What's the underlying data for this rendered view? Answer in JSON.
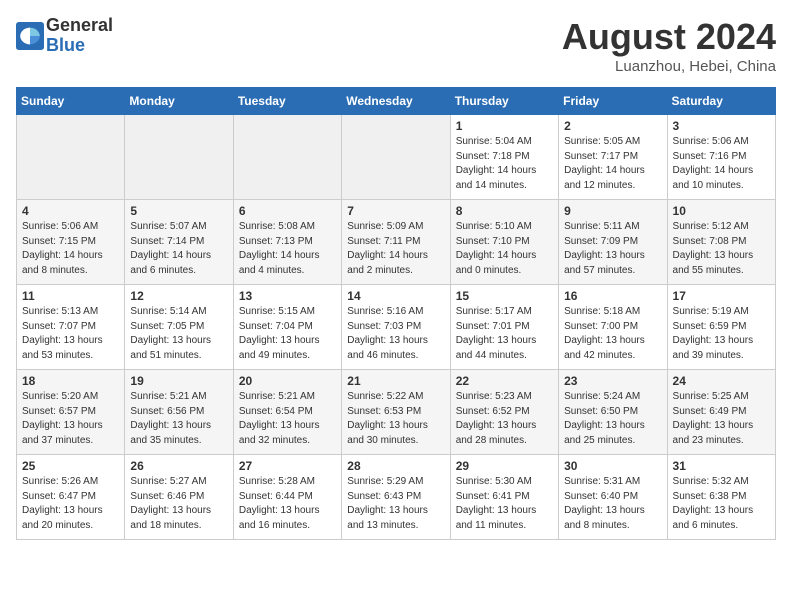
{
  "logo": {
    "line1": "General",
    "line2": "Blue"
  },
  "title": "August 2024",
  "location": "Luanzhou, Hebei, China",
  "weekdays": [
    "Sunday",
    "Monday",
    "Tuesday",
    "Wednesday",
    "Thursday",
    "Friday",
    "Saturday"
  ],
  "weeks": [
    [
      {
        "day": "",
        "info": ""
      },
      {
        "day": "",
        "info": ""
      },
      {
        "day": "",
        "info": ""
      },
      {
        "day": "",
        "info": ""
      },
      {
        "day": "1",
        "info": "Sunrise: 5:04 AM\nSunset: 7:18 PM\nDaylight: 14 hours\nand 14 minutes."
      },
      {
        "day": "2",
        "info": "Sunrise: 5:05 AM\nSunset: 7:17 PM\nDaylight: 14 hours\nand 12 minutes."
      },
      {
        "day": "3",
        "info": "Sunrise: 5:06 AM\nSunset: 7:16 PM\nDaylight: 14 hours\nand 10 minutes."
      }
    ],
    [
      {
        "day": "4",
        "info": "Sunrise: 5:06 AM\nSunset: 7:15 PM\nDaylight: 14 hours\nand 8 minutes."
      },
      {
        "day": "5",
        "info": "Sunrise: 5:07 AM\nSunset: 7:14 PM\nDaylight: 14 hours\nand 6 minutes."
      },
      {
        "day": "6",
        "info": "Sunrise: 5:08 AM\nSunset: 7:13 PM\nDaylight: 14 hours\nand 4 minutes."
      },
      {
        "day": "7",
        "info": "Sunrise: 5:09 AM\nSunset: 7:11 PM\nDaylight: 14 hours\nand 2 minutes."
      },
      {
        "day": "8",
        "info": "Sunrise: 5:10 AM\nSunset: 7:10 PM\nDaylight: 14 hours\nand 0 minutes."
      },
      {
        "day": "9",
        "info": "Sunrise: 5:11 AM\nSunset: 7:09 PM\nDaylight: 13 hours\nand 57 minutes."
      },
      {
        "day": "10",
        "info": "Sunrise: 5:12 AM\nSunset: 7:08 PM\nDaylight: 13 hours\nand 55 minutes."
      }
    ],
    [
      {
        "day": "11",
        "info": "Sunrise: 5:13 AM\nSunset: 7:07 PM\nDaylight: 13 hours\nand 53 minutes."
      },
      {
        "day": "12",
        "info": "Sunrise: 5:14 AM\nSunset: 7:05 PM\nDaylight: 13 hours\nand 51 minutes."
      },
      {
        "day": "13",
        "info": "Sunrise: 5:15 AM\nSunset: 7:04 PM\nDaylight: 13 hours\nand 49 minutes."
      },
      {
        "day": "14",
        "info": "Sunrise: 5:16 AM\nSunset: 7:03 PM\nDaylight: 13 hours\nand 46 minutes."
      },
      {
        "day": "15",
        "info": "Sunrise: 5:17 AM\nSunset: 7:01 PM\nDaylight: 13 hours\nand 44 minutes."
      },
      {
        "day": "16",
        "info": "Sunrise: 5:18 AM\nSunset: 7:00 PM\nDaylight: 13 hours\nand 42 minutes."
      },
      {
        "day": "17",
        "info": "Sunrise: 5:19 AM\nSunset: 6:59 PM\nDaylight: 13 hours\nand 39 minutes."
      }
    ],
    [
      {
        "day": "18",
        "info": "Sunrise: 5:20 AM\nSunset: 6:57 PM\nDaylight: 13 hours\nand 37 minutes."
      },
      {
        "day": "19",
        "info": "Sunrise: 5:21 AM\nSunset: 6:56 PM\nDaylight: 13 hours\nand 35 minutes."
      },
      {
        "day": "20",
        "info": "Sunrise: 5:21 AM\nSunset: 6:54 PM\nDaylight: 13 hours\nand 32 minutes."
      },
      {
        "day": "21",
        "info": "Sunrise: 5:22 AM\nSunset: 6:53 PM\nDaylight: 13 hours\nand 30 minutes."
      },
      {
        "day": "22",
        "info": "Sunrise: 5:23 AM\nSunset: 6:52 PM\nDaylight: 13 hours\nand 28 minutes."
      },
      {
        "day": "23",
        "info": "Sunrise: 5:24 AM\nSunset: 6:50 PM\nDaylight: 13 hours\nand 25 minutes."
      },
      {
        "day": "24",
        "info": "Sunrise: 5:25 AM\nSunset: 6:49 PM\nDaylight: 13 hours\nand 23 minutes."
      }
    ],
    [
      {
        "day": "25",
        "info": "Sunrise: 5:26 AM\nSunset: 6:47 PM\nDaylight: 13 hours\nand 20 minutes."
      },
      {
        "day": "26",
        "info": "Sunrise: 5:27 AM\nSunset: 6:46 PM\nDaylight: 13 hours\nand 18 minutes."
      },
      {
        "day": "27",
        "info": "Sunrise: 5:28 AM\nSunset: 6:44 PM\nDaylight: 13 hours\nand 16 minutes."
      },
      {
        "day": "28",
        "info": "Sunrise: 5:29 AM\nSunset: 6:43 PM\nDaylight: 13 hours\nand 13 minutes."
      },
      {
        "day": "29",
        "info": "Sunrise: 5:30 AM\nSunset: 6:41 PM\nDaylight: 13 hours\nand 11 minutes."
      },
      {
        "day": "30",
        "info": "Sunrise: 5:31 AM\nSunset: 6:40 PM\nDaylight: 13 hours\nand 8 minutes."
      },
      {
        "day": "31",
        "info": "Sunrise: 5:32 AM\nSunset: 6:38 PM\nDaylight: 13 hours\nand 6 minutes."
      }
    ]
  ]
}
